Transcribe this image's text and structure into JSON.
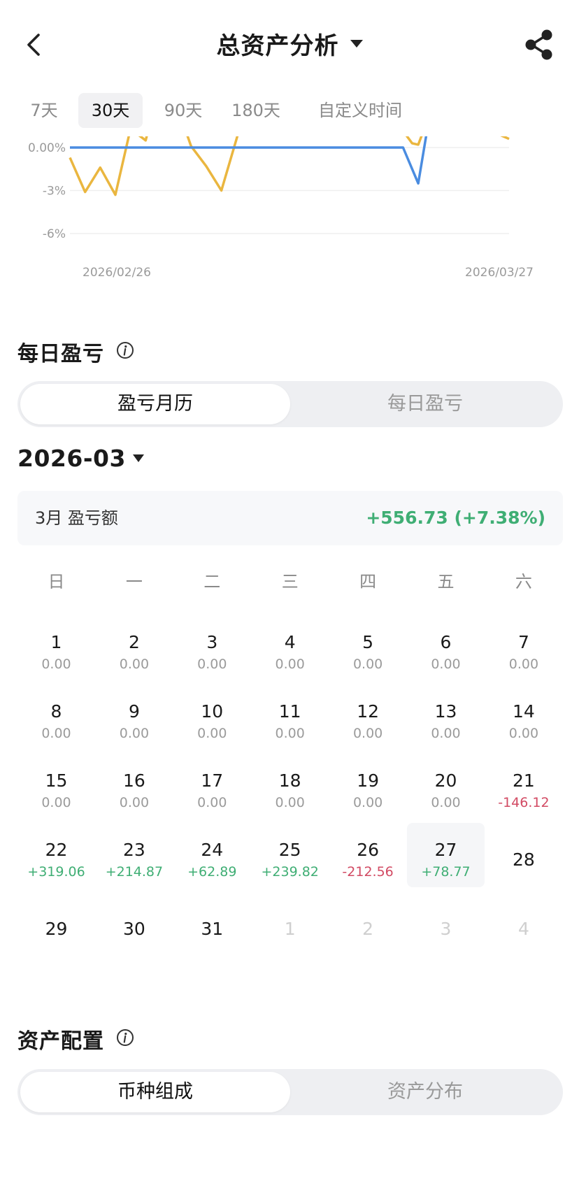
{
  "header": {
    "title": "总资产分析",
    "back_icon": "chevron-left-icon",
    "share_icon": "share-icon"
  },
  "range_tabs": [
    {
      "label": "7天",
      "active": false
    },
    {
      "label": "30天",
      "active": true
    },
    {
      "label": "90天",
      "active": false
    },
    {
      "label": "180天",
      "active": false
    },
    {
      "label": "自定义时间",
      "active": false
    }
  ],
  "chart_data": {
    "type": "line",
    "x_start_label": "2026/02/26",
    "x_end_label": "2026/03/27",
    "ytick_labels": [
      "0.00%",
      "-3%",
      "-6%"
    ],
    "ylim": [
      -6,
      0
    ],
    "grid": true,
    "series": [
      {
        "color": "#eab63f",
        "points": [
          {
            "x": 0,
            "y": -0.7
          },
          {
            "x": 1,
            "y": -3.1
          },
          {
            "x": 2,
            "y": -1.4
          },
          {
            "x": 3,
            "y": -3.3
          },
          {
            "x": 4,
            "y": 1.3
          },
          {
            "x": 5,
            "y": 0.5
          },
          {
            "x": 5.2,
            "y": 1.3
          },
          {
            "x": 7.6,
            "y": 1.3
          },
          {
            "x": 8,
            "y": 0.1
          },
          {
            "x": 9,
            "y": -1.3
          },
          {
            "x": 10,
            "y": -3.0
          },
          {
            "x": 11.2,
            "y": 1.3
          },
          {
            "x": 21.9,
            "y": 1.3
          },
          {
            "x": 22.6,
            "y": 0.3
          },
          {
            "x": 23.0,
            "y": 0.2
          },
          {
            "x": 23.4,
            "y": 1.3
          },
          {
            "x": 27.5,
            "y": 1.3
          },
          {
            "x": 29,
            "y": 0.6
          }
        ]
      },
      {
        "color": "#4a8ce0",
        "points": [
          {
            "x": 0,
            "y": 0
          },
          {
            "x": 22,
            "y": 0
          },
          {
            "x": 23,
            "y": -2.5
          },
          {
            "x": 23.6,
            "y": 1.3
          }
        ]
      }
    ]
  },
  "daily_pnl": {
    "title": "每日盈亏",
    "info_icon": "info-icon",
    "segments": [
      "盈亏月历",
      "每日盈亏"
    ],
    "month": "2026-03",
    "summary_label": "3月 盈亏额",
    "summary_value": "+556.73 (+7.38%)",
    "weekdays": [
      "日",
      "一",
      "二",
      "三",
      "四",
      "五",
      "六"
    ],
    "days": [
      {
        "day": "1",
        "value": "0.00",
        "sign": "zero"
      },
      {
        "day": "2",
        "value": "0.00",
        "sign": "zero"
      },
      {
        "day": "3",
        "value": "0.00",
        "sign": "zero"
      },
      {
        "day": "4",
        "value": "0.00",
        "sign": "zero"
      },
      {
        "day": "5",
        "value": "0.00",
        "sign": "zero"
      },
      {
        "day": "6",
        "value": "0.00",
        "sign": "zero"
      },
      {
        "day": "7",
        "value": "0.00",
        "sign": "zero"
      },
      {
        "day": "8",
        "value": "0.00",
        "sign": "zero"
      },
      {
        "day": "9",
        "value": "0.00",
        "sign": "zero"
      },
      {
        "day": "10",
        "value": "0.00",
        "sign": "zero"
      },
      {
        "day": "11",
        "value": "0.00",
        "sign": "zero"
      },
      {
        "day": "12",
        "value": "0.00",
        "sign": "zero"
      },
      {
        "day": "13",
        "value": "0.00",
        "sign": "zero"
      },
      {
        "day": "14",
        "value": "0.00",
        "sign": "zero"
      },
      {
        "day": "15",
        "value": "0.00",
        "sign": "zero"
      },
      {
        "day": "16",
        "value": "0.00",
        "sign": "zero"
      },
      {
        "day": "17",
        "value": "0.00",
        "sign": "zero"
      },
      {
        "day": "18",
        "value": "0.00",
        "sign": "zero"
      },
      {
        "day": "19",
        "value": "0.00",
        "sign": "zero"
      },
      {
        "day": "20",
        "value": "0.00",
        "sign": "zero"
      },
      {
        "day": "21",
        "value": "-146.12",
        "sign": "neg"
      },
      {
        "day": "22",
        "value": "+319.06",
        "sign": "pos"
      },
      {
        "day": "23",
        "value": "+214.87",
        "sign": "pos"
      },
      {
        "day": "24",
        "value": "+62.89",
        "sign": "pos"
      },
      {
        "day": "25",
        "value": "+239.82",
        "sign": "pos"
      },
      {
        "day": "26",
        "value": "-212.56",
        "sign": "neg"
      },
      {
        "day": "27",
        "value": "+78.77",
        "sign": "pos",
        "today": true
      },
      {
        "day": "28",
        "value": "",
        "sign": "none"
      },
      {
        "day": "29",
        "value": "",
        "sign": "none"
      },
      {
        "day": "30",
        "value": "",
        "sign": "none"
      },
      {
        "day": "31",
        "value": "",
        "sign": "none"
      },
      {
        "day": "1",
        "value": "",
        "sign": "none",
        "other_month": true
      },
      {
        "day": "2",
        "value": "",
        "sign": "none",
        "other_month": true
      },
      {
        "day": "3",
        "value": "",
        "sign": "none",
        "other_month": true
      },
      {
        "day": "4",
        "value": "",
        "sign": "none",
        "other_month": true
      }
    ]
  },
  "asset_allocation": {
    "title": "资产配置",
    "info_icon": "info-icon",
    "segments": [
      "币种组成",
      "资产分布"
    ]
  },
  "colors": {
    "positive": "#3fae74",
    "negative": "#d24a63",
    "chart_yellow": "#eab63f",
    "chart_blue": "#4a8ce0"
  }
}
